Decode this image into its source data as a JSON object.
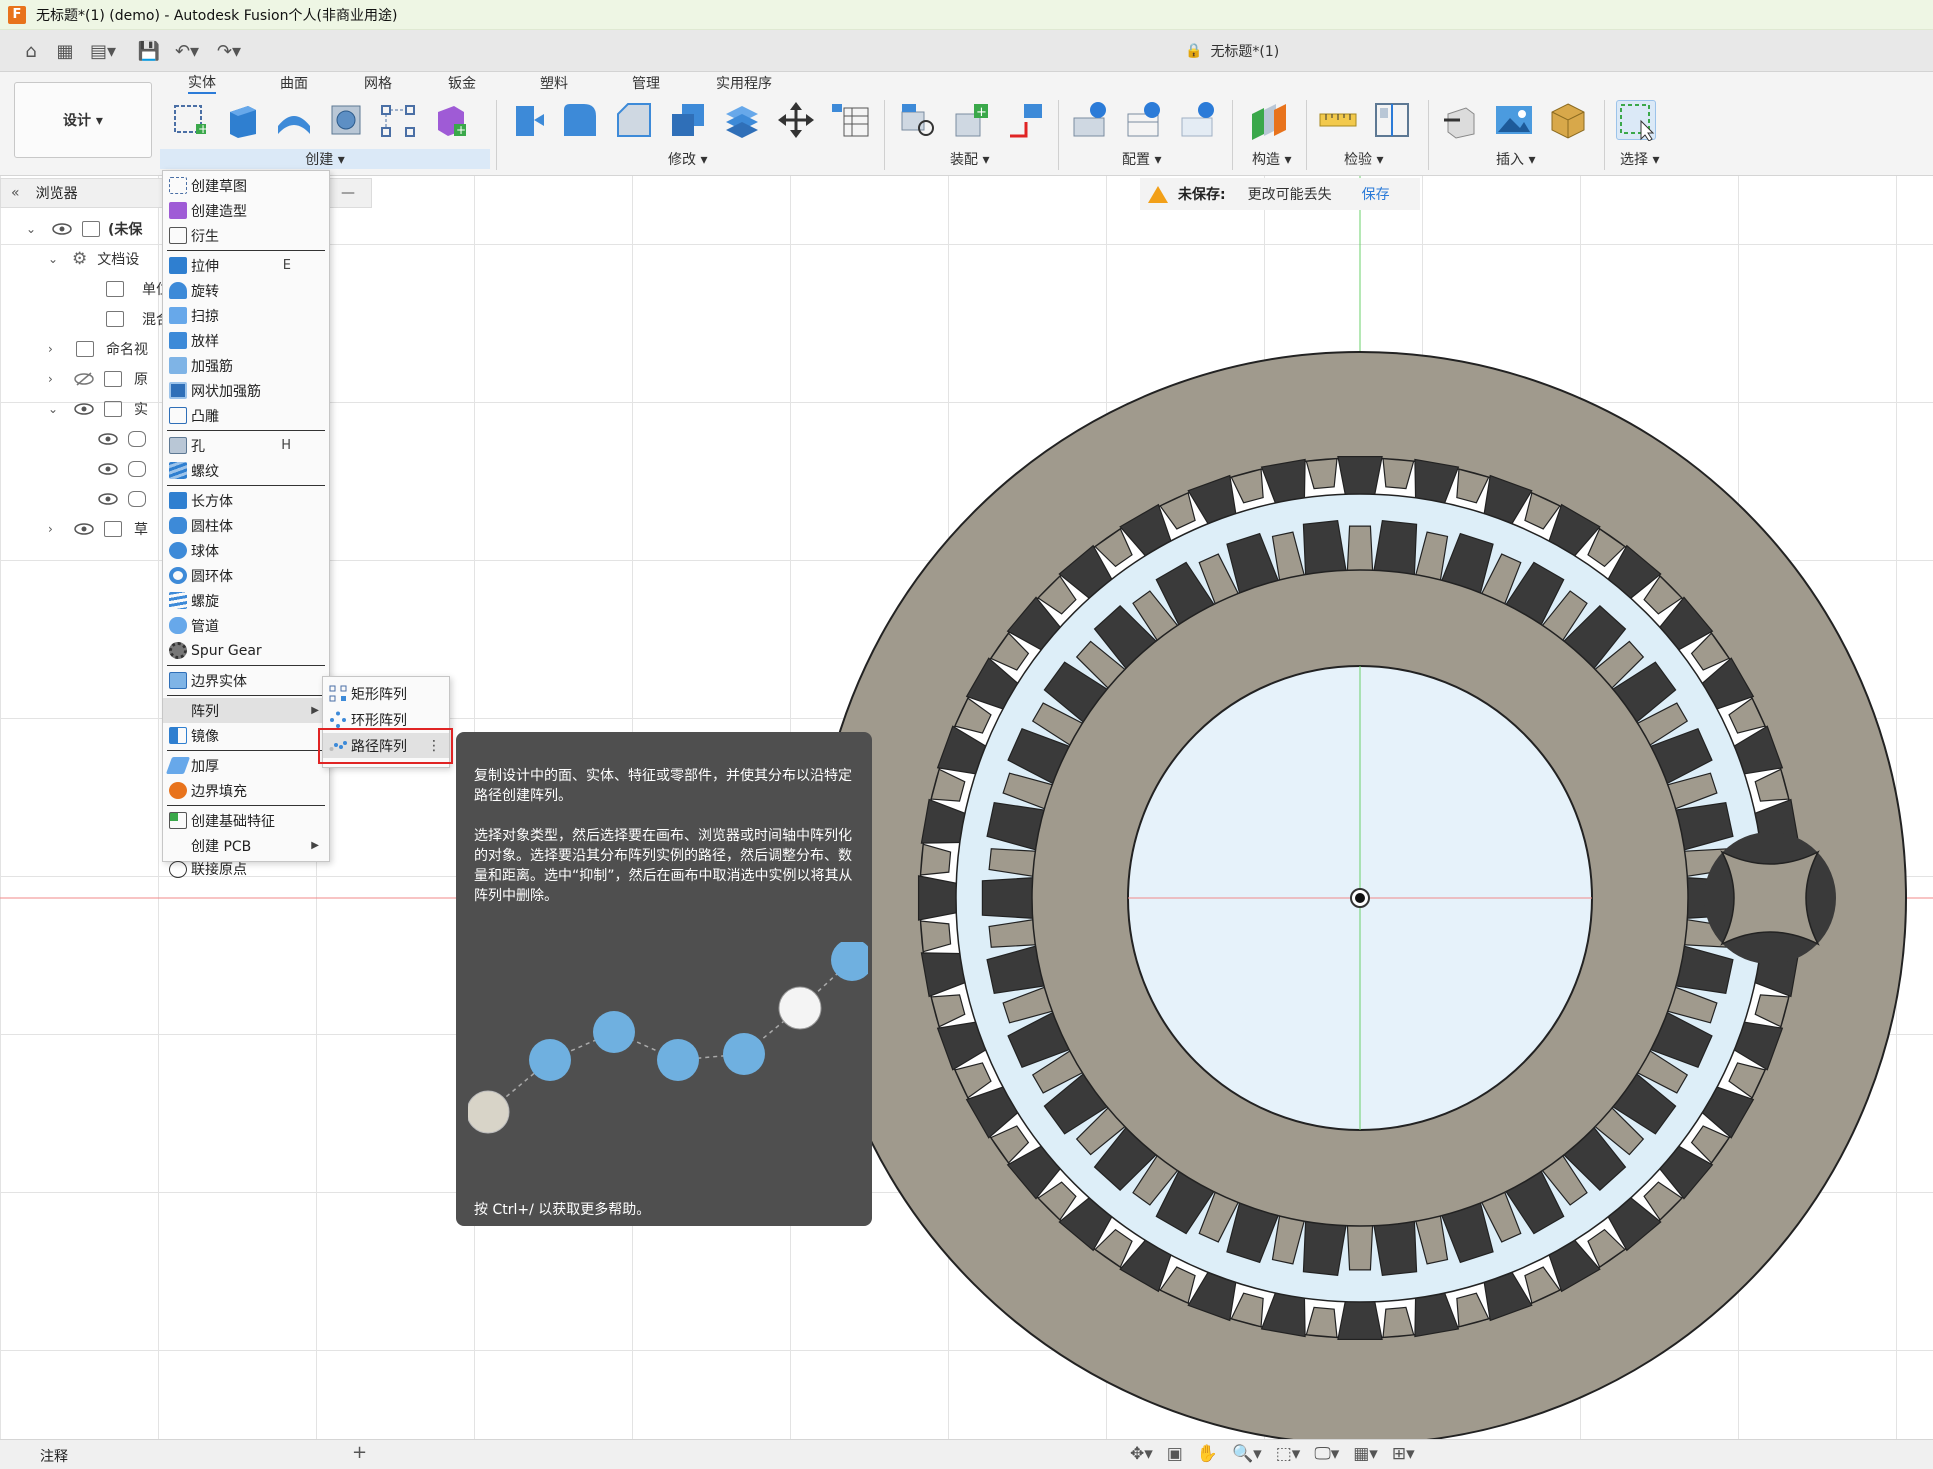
{
  "titlebar": {
    "logo": "F",
    "title": "无标题*(1) (demo) - Autodesk Fusion个人(非商业用途)"
  },
  "document": {
    "tab_title": "无标题*(1)"
  },
  "workspace": {
    "label": "设计 ▾"
  },
  "ribbon": {
    "tabs": [
      "实体",
      "曲面",
      "网格",
      "钣金",
      "塑料",
      "管理",
      "实用程序"
    ],
    "groups": [
      "创建 ▾",
      "修改 ▾",
      "装配 ▾",
      "配置 ▾",
      "构造 ▾",
      "检验 ▾",
      "插入 ▾",
      "选择 ▾"
    ]
  },
  "warning": {
    "title": "未保存:",
    "message": "更改可能丢失",
    "save": "保存"
  },
  "browser": {
    "title": "浏览器",
    "rows": [
      "(未保",
      "文档设",
      "单位",
      "混合",
      "命名视",
      "原",
      "实",
      "",
      "",
      "",
      "草"
    ]
  },
  "menu": {
    "items": [
      {
        "label": "创建草图"
      },
      {
        "label": "创建造型"
      },
      {
        "label": "衍生"
      },
      {
        "label": "拉伸",
        "shortcut": "E"
      },
      {
        "label": "旋转"
      },
      {
        "label": "扫掠"
      },
      {
        "label": "放样"
      },
      {
        "label": "加强筋"
      },
      {
        "label": "网状加强筋"
      },
      {
        "label": "凸雕"
      },
      {
        "label": "孔",
        "shortcut": "H"
      },
      {
        "label": "螺纹"
      },
      {
        "label": "长方体"
      },
      {
        "label": "圆柱体"
      },
      {
        "label": "球体"
      },
      {
        "label": "圆环体"
      },
      {
        "label": "螺旋"
      },
      {
        "label": "管道"
      },
      {
        "label": "Spur Gear"
      },
      {
        "label": "边界实体"
      },
      {
        "label": "阵列"
      },
      {
        "label": "镜像"
      },
      {
        "label": "加厚"
      },
      {
        "label": "边界填充"
      },
      {
        "label": "创建基础特征"
      },
      {
        "label": "创建 PCB"
      },
      {
        "label": "联接原点"
      }
    ]
  },
  "submenu": {
    "items": [
      "矩形阵列",
      "环形阵列",
      "路径阵列"
    ],
    "more": "⋮"
  },
  "tooltip": {
    "p1": "复制设计中的面、实体、特征或零部件，并使其分布以沿特定路径创建阵列。",
    "p2": "选择对象类型，然后选择要在画布、浏览器或时间轴中阵列化的对象。选择要沿其分布阵列实例的路径，然后调整分布、数量和距离。选中“抑制”，然后在画布中取消选中实例以将其从阵列中删除。",
    "help": "按 Ctrl+/ 以获取更多帮助。"
  },
  "bottom": {
    "notes": "注释",
    "plus": "+"
  },
  "colors": {
    "accent": "#2b7bd8",
    "gear": "#a09a8d",
    "gear_dark": "#3a3a3a",
    "disc": "#ddeef8",
    "highlight": "#e02424"
  }
}
